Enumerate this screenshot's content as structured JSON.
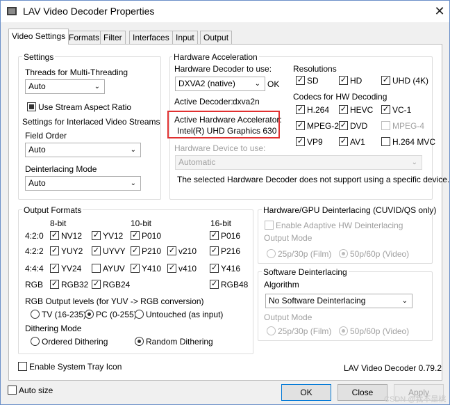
{
  "window": {
    "title": "LAV Video Decoder Properties"
  },
  "tabs": [
    "Video Settings",
    "Formats",
    "Filter",
    "Interfaces",
    "Input",
    "Output"
  ],
  "settings": {
    "title": "Settings",
    "threads_label": "Threads for Multi-Threading",
    "threads_value": "Auto",
    "stream_aspect": "Use Stream Aspect Ratio",
    "interlaced_title": "Settings for Interlaced Video Streams",
    "field_order_label": "Field Order",
    "field_order_value": "Auto",
    "deint_mode_label": "Deinterlacing Mode",
    "deint_mode_value": "Auto"
  },
  "hwaccel": {
    "title": "Hardware Acceleration",
    "decoder_label": "Hardware Decoder to use:",
    "decoder_value": "DXVA2 (native)",
    "ok": "OK",
    "active_decoder_label": "Active Decoder:",
    "active_decoder_value": "dxva2n",
    "active_accel_label": "Active Hardware Accelerator:",
    "active_accel_value": "Intel(R) UHD Graphics 630",
    "device_label": "Hardware Device to use:",
    "device_value": "Automatic",
    "note": "The selected Hardware Decoder does not support using a specific device.",
    "resolutions_label": "Resolutions",
    "res": [
      "SD",
      "HD",
      "UHD (4K)"
    ],
    "codecs_label": "Codecs for HW Decoding",
    "codecs": [
      "H.264",
      "HEVC",
      "VC-1",
      "MPEG-2",
      "DVD",
      "MPEG-4",
      "VP9",
      "AV1",
      "H.264 MVC"
    ]
  },
  "output": {
    "title": "Output Formats",
    "col_8bit": "8-bit",
    "col_10bit": "10-bit",
    "col_16bit": "16-bit",
    "row_420": "4:2:0",
    "row_422": "4:2:2",
    "row_444": "4:4:4",
    "row_rgb": "RGB",
    "f": [
      "NV12",
      "YV12",
      "P010",
      "P016",
      "YUY2",
      "UYVY",
      "P210",
      "v210",
      "P216",
      "YV24",
      "AYUV",
      "Y410",
      "v410",
      "Y416",
      "RGB32",
      "RGB24",
      "RGB48"
    ],
    "rgb_levels_label": "RGB Output levels (for YUV -> RGB conversion)",
    "tv": "TV (16-235)",
    "pc": "PC (0-255)",
    "untouched": "Untouched (as input)",
    "dither_label": "Dithering Mode",
    "ordered": "Ordered Dithering",
    "random": "Random Dithering"
  },
  "hwdeint": {
    "title": "Hardware/GPU Deinterlacing (CUVID/QS only)",
    "adaptive": "Enable Adaptive HW Deinterlacing",
    "output_mode": "Output Mode",
    "opt1": "25p/30p (Film)",
    "opt2": "50p/60p (Video)"
  },
  "swdeint": {
    "title": "Software Deinterlacing",
    "algorithm": "Algorithm",
    "algorithm_value": "No Software Deinterlacing",
    "output_mode": "Output Mode",
    "opt1": "25p/30p (Film)",
    "opt2": "50p/60p (Video)"
  },
  "tray": "Enable System Tray Icon",
  "version": "LAV Video Decoder 0.79.2",
  "autosize": "Auto size",
  "buttons": {
    "ok": "OK",
    "close": "Close",
    "apply": "Apply"
  },
  "watermark": "CSDN @我不是桃"
}
